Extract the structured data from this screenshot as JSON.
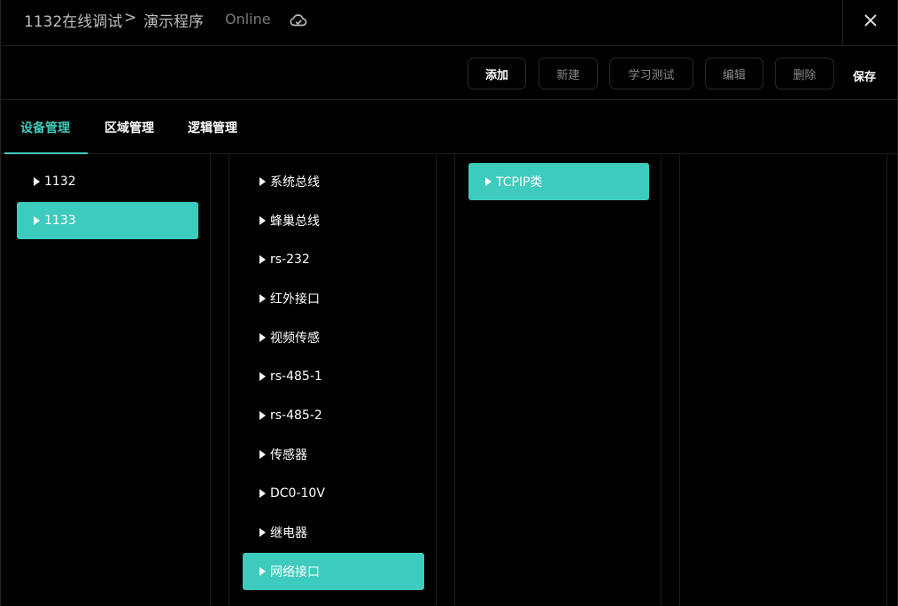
{
  "titlebar": {
    "breadcrumb_root": "1132在线调试",
    "breadcrumb_sep": ">",
    "breadcrumb_page": "演示程序",
    "status": "Online",
    "cloud_icon": "cloud-check-icon",
    "close_icon": "close-icon"
  },
  "toolbar": {
    "add_label": "添加",
    "new_label": "新建",
    "learn_label": "学习测试",
    "edit_label": "编辑",
    "delete_label": "删除",
    "save_label": "保存"
  },
  "tabs": [
    {
      "label": "设备管理",
      "active": true
    },
    {
      "label": "区域管理",
      "active": false
    },
    {
      "label": "逻辑管理",
      "active": false
    }
  ],
  "columns": {
    "col1": [
      {
        "label": "1132",
        "selected": false
      },
      {
        "label": "1133",
        "selected": true
      }
    ],
    "col2": [
      {
        "label": "系统总线",
        "selected": false
      },
      {
        "label": "蜂巢总线",
        "selected": false
      },
      {
        "label": "rs-232",
        "selected": false
      },
      {
        "label": "红外接口",
        "selected": false
      },
      {
        "label": "视频传感",
        "selected": false
      },
      {
        "label": "rs-485-1",
        "selected": false
      },
      {
        "label": "rs-485-2",
        "selected": false
      },
      {
        "label": "传感器",
        "selected": false
      },
      {
        "label": "DC0-10V",
        "selected": false
      },
      {
        "label": "继电器",
        "selected": false
      },
      {
        "label": "网络接口",
        "selected": true
      }
    ],
    "col3": [
      {
        "label": "TCPIP类",
        "selected": true
      }
    ]
  },
  "colors": {
    "accent": "#3dcbbd",
    "background": "#000000",
    "text": "#ffffff",
    "muted": "#8a8a8a"
  }
}
